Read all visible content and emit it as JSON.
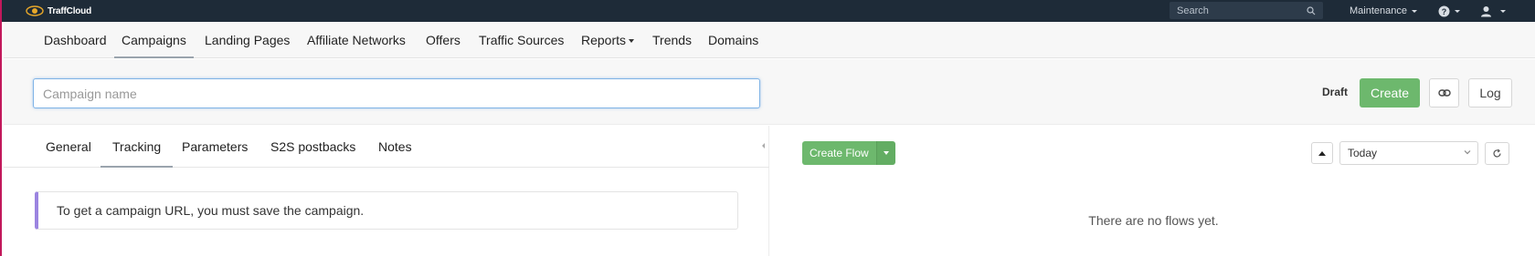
{
  "app": {
    "logo_text": "TraffCloud"
  },
  "topbar": {
    "search_placeholder": "Search",
    "maintenance_label": "Maintenance",
    "help_icon": "question-circle-icon",
    "user_icon": "user-icon"
  },
  "nav": {
    "items": [
      {
        "label": "Dashboard"
      },
      {
        "label": "Campaigns",
        "active": true
      },
      {
        "label": "Landing Pages"
      },
      {
        "label": "Affiliate Networks"
      },
      {
        "label": "Offers"
      },
      {
        "label": "Traffic Sources"
      },
      {
        "label": "Reports",
        "dropdown": true
      },
      {
        "label": "Trends"
      },
      {
        "label": "Domains"
      }
    ]
  },
  "campaign": {
    "name_placeholder": "Campaign name",
    "name_value": "",
    "status": "Draft",
    "create_label": "Create",
    "link_icon": "link-icon",
    "log_label": "Log"
  },
  "tabs": [
    {
      "label": "General"
    },
    {
      "label": "Tracking",
      "active": true
    },
    {
      "label": "Parameters"
    },
    {
      "label": "S2S postbacks"
    },
    {
      "label": "Notes"
    }
  ],
  "notice": {
    "text": "To get a campaign URL, you must save the campaign."
  },
  "flows": {
    "create_flow_label": "Create Flow",
    "date_range": "Today",
    "empty_text": "There are no flows yet."
  },
  "colors": {
    "topbar": "#1e2b38",
    "primary_green": "#6db86d",
    "notice_accent": "#9b84e0",
    "input_focus": "#7fb3e6"
  }
}
